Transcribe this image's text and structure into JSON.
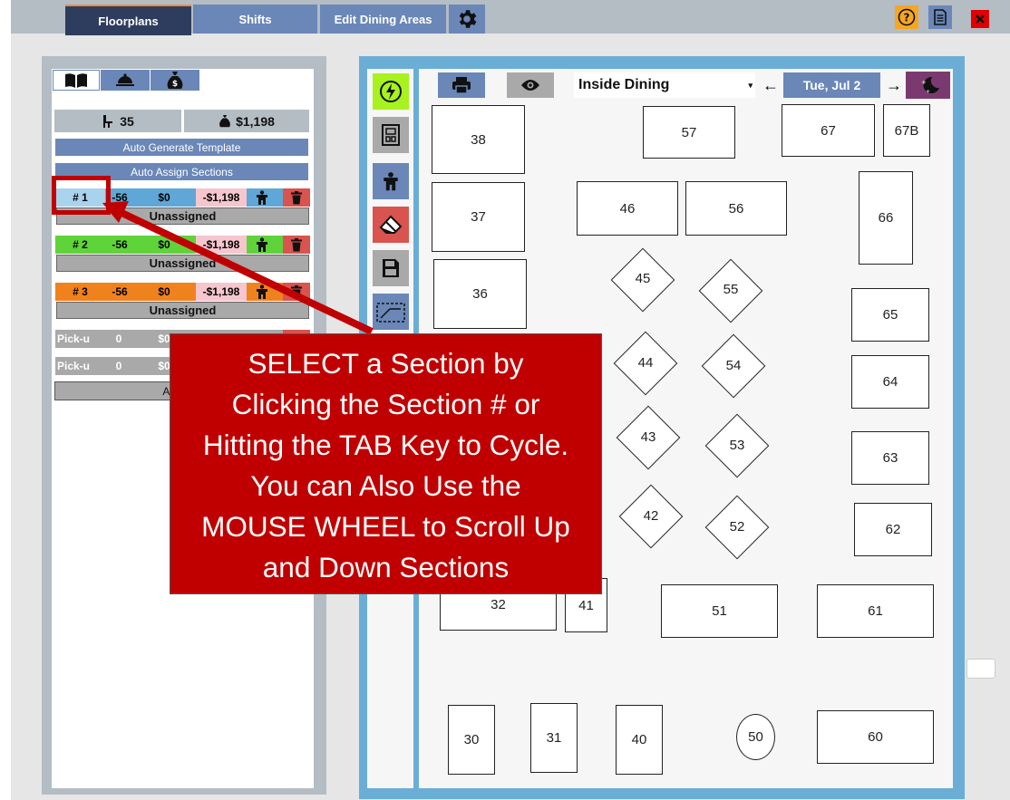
{
  "tabs": [
    {
      "label": "Floorplans",
      "active": true
    },
    {
      "label": "Shifts",
      "active": false
    },
    {
      "label": "Edit Dining Areas",
      "active": false
    }
  ],
  "icons": {
    "settings": "gear-icon",
    "help": "question-icon",
    "notes": "document-icon",
    "close": "close-icon"
  },
  "left_panel": {
    "view_tabs": [
      "book-icon",
      "cloche-icon",
      "money-bag-icon"
    ],
    "covers": "35",
    "revenue": "$1,198",
    "auto_generate_label": "Auto Generate Template",
    "auto_assign_label": "Auto Assign Sections",
    "sections": [
      {
        "num": "# 1",
        "covers": "-56",
        "amount": "$0",
        "diff": "-$1,198",
        "server": "Unassigned",
        "color": "#a9d3ec"
      },
      {
        "num": "# 2",
        "covers": "-56",
        "amount": "$0",
        "diff": "-$1,198",
        "server": "Unassigned",
        "color": "#5fd33a"
      },
      {
        "num": "# 3",
        "covers": "-56",
        "amount": "$0",
        "diff": "-$1,198",
        "server": "Unassigned",
        "color": "#f0821e"
      }
    ],
    "pickups": [
      {
        "label": "Pick-u",
        "covers": "0",
        "amount": "$0"
      },
      {
        "label": "Pick-u",
        "covers": "0",
        "amount": "$0"
      }
    ],
    "add_pickup_label": "Add Pic"
  },
  "toolbar": {
    "dining_area": "Inside Dining",
    "date": "Tue, Jul 2",
    "prev_arrow": "←",
    "next_arrow": "→"
  },
  "tables": [
    "38",
    "57",
    "67",
    "67B",
    "37",
    "46",
    "56",
    "66",
    "36",
    "45",
    "55",
    "65",
    "44",
    "54",
    "64",
    "43",
    "53",
    "63",
    "42",
    "52",
    "62",
    "32",
    "41",
    "51",
    "61",
    "30",
    "31",
    "40",
    "50",
    "60"
  ],
  "callout": {
    "lines": [
      "SELECT a Section by",
      "Clicking the Section # or",
      "Hitting the TAB Key to Cycle.",
      "You can Also Use the",
      "MOUSE WHEEL to Scroll Up",
      "and Down Sections"
    ]
  },
  "colors": {
    "accent_red": "#c00000",
    "panel_blue": "#6aaed6",
    "button_blue": "#6a87b8",
    "active_tab": "#2e3d5e",
    "help_orange": "#f5a623",
    "lime": "#a7f21f"
  }
}
